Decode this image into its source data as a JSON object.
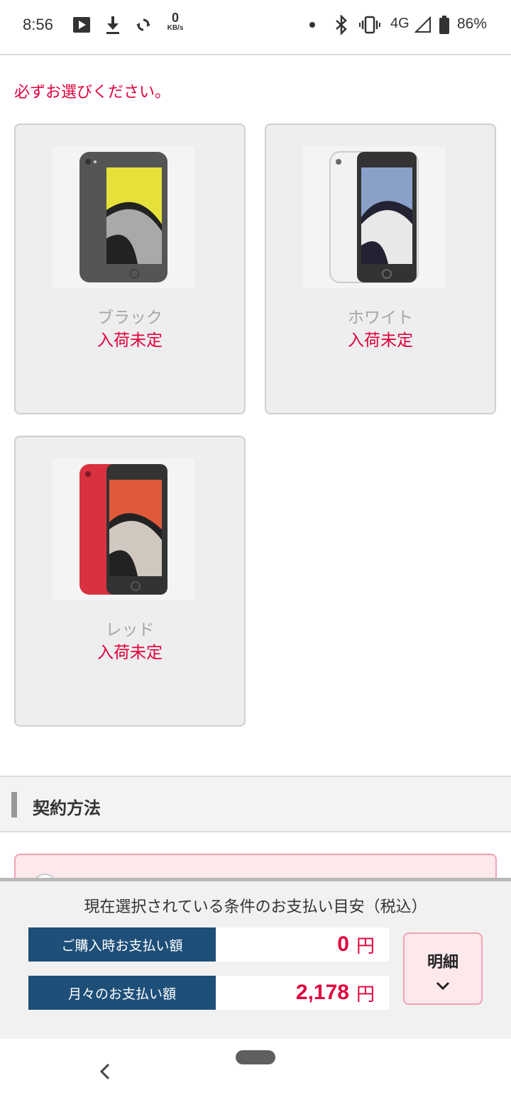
{
  "status_bar": {
    "time": "8:56",
    "speed_value": "0",
    "speed_unit": "KB/s",
    "network": "4G",
    "battery": "86%",
    "icons": [
      "play-store-icon",
      "download-icon",
      "sync-icon",
      "dot-icon",
      "bluetooth-icon",
      "vibrate-icon",
      "signal-icon",
      "battery-icon"
    ]
  },
  "notice": "必ずお選びください。",
  "colors": [
    {
      "name": "ブラック",
      "stock": "入荷未定",
      "body_color": "#555555",
      "screen_color": "#e6e13a"
    },
    {
      "name": "ホワイト",
      "stock": "入荷未定",
      "body_color": "#f2f2f2",
      "screen_color": "#8aa0c8"
    },
    {
      "name": "レッド",
      "stock": "入荷未定",
      "body_color": "#d9313f",
      "screen_color": "#e05a3a"
    }
  ],
  "section": {
    "title": "契約方法"
  },
  "payment": {
    "title": "現在選択されている条件のお支払い目安（税込）",
    "rows": [
      {
        "label": "ご購入時お支払い額",
        "value": "0",
        "unit": "円"
      },
      {
        "label": "月々のお支払い額",
        "value": "2,178",
        "unit": "円"
      }
    ],
    "detail_label": "明細"
  },
  "theme": {
    "accent": "#e0003c",
    "label_bg": "#1e4f78",
    "pink_bg": "#fde8ec"
  }
}
